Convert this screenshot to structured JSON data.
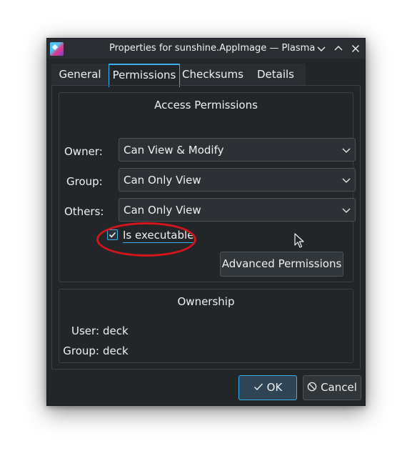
{
  "window": {
    "title": "Properties for sunshine.AppImage — Plasma"
  },
  "tabs": [
    {
      "label": "General"
    },
    {
      "label": "Permissions"
    },
    {
      "label": "Checksums"
    },
    {
      "label": "Details"
    }
  ],
  "access": {
    "title": "Access Permissions",
    "owner_label": "Owner:",
    "owner_value": "Can View & Modify",
    "group_label": "Group:",
    "group_value": "Can Only View",
    "others_label": "Others:",
    "others_value": "Can Only View",
    "executable_label": "Is executable",
    "executable_checked": true,
    "advanced_label": "Advanced Permissions"
  },
  "ownership": {
    "title": "Ownership",
    "user_label": "User:",
    "user_value": "deck",
    "group_label": "Group:",
    "group_value": "deck"
  },
  "footer": {
    "ok_label": "OK",
    "cancel_label": "Cancel"
  },
  "colors": {
    "accent": "#3daee9",
    "window_bg": "#232629",
    "annotation": "#d6141b"
  },
  "icons": {
    "app": "appimage-icon",
    "minimize": "chevron-down-icon",
    "maximize": "chevron-up-icon",
    "close": "close-icon",
    "dropdown": "chevron-down-icon",
    "check": "check-icon",
    "cancel": "cancel-icon"
  }
}
